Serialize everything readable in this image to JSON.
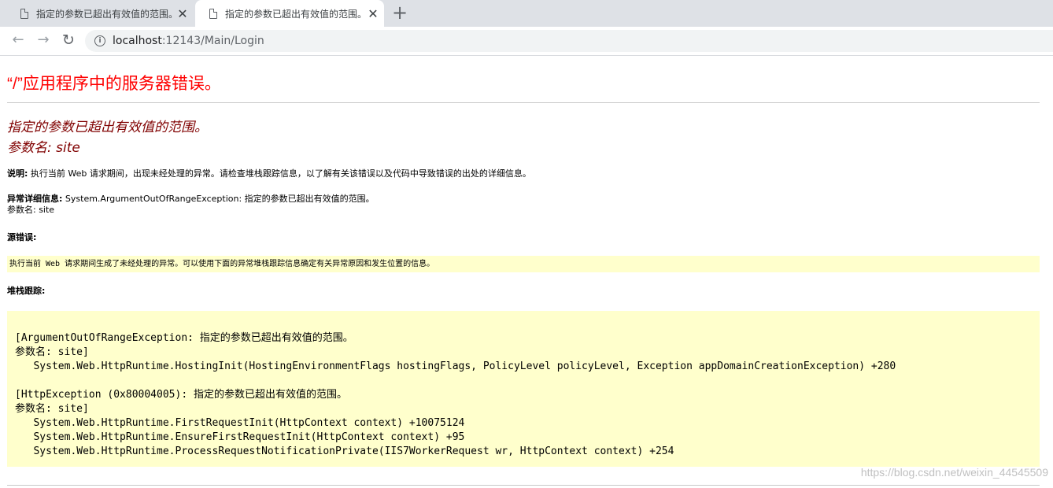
{
  "browser": {
    "tabs": [
      {
        "title": "指定的参数已超出有效值的范围。",
        "active": false
      },
      {
        "title": "指定的参数已超出有效值的范围。",
        "active": true
      }
    ],
    "new_tab_label": "+",
    "address": {
      "host": "localhost",
      "path": ":12143/Main/Login"
    }
  },
  "page": {
    "error_title": "“/”应用程序中的服务器错误。",
    "message_line1": "指定的参数已超出有效值的范围。",
    "message_line2": "参数名: site",
    "description_label": "说明:",
    "description_text": " 执行当前 Web 请求期间，出现未经处理的异常。请检查堆栈跟踪信息，以了解有关该错误以及代码中导致错误的出处的详细信息。",
    "detail_label": "异常详细信息:",
    "detail_text": " System.ArgumentOutOfRangeException: 指定的参数已超出有效值的范围。",
    "detail_param": "参数名: site",
    "source_label": "源错误:",
    "source_text": "执行当前 Web 请求期间生成了未经处理的异常。可以使用下面的异常堆栈跟踪信息确定有关异常原因和发生位置的信息。",
    "stack_label": "堆栈跟踪:",
    "stack_trace": "[ArgumentOutOfRangeException: 指定的参数已超出有效值的范围。\n参数名: site]\n   System.Web.HttpRuntime.HostingInit(HostingEnvironmentFlags hostingFlags, PolicyLevel policyLevel, Exception appDomainCreationException) +280\n\n[HttpException (0x80004005): 指定的参数已超出有效值的范围。\n参数名: site]\n   System.Web.HttpRuntime.FirstRequestInit(HttpContext context) +10075124\n   System.Web.HttpRuntime.EnsureFirstRequestInit(HttpContext context) +95\n   System.Web.HttpRuntime.ProcessRequestNotificationPrivate(IIS7WorkerRequest wr, HttpContext context) +254"
  },
  "watermark": "https://blog.csdn.net/weixin_44545509"
}
